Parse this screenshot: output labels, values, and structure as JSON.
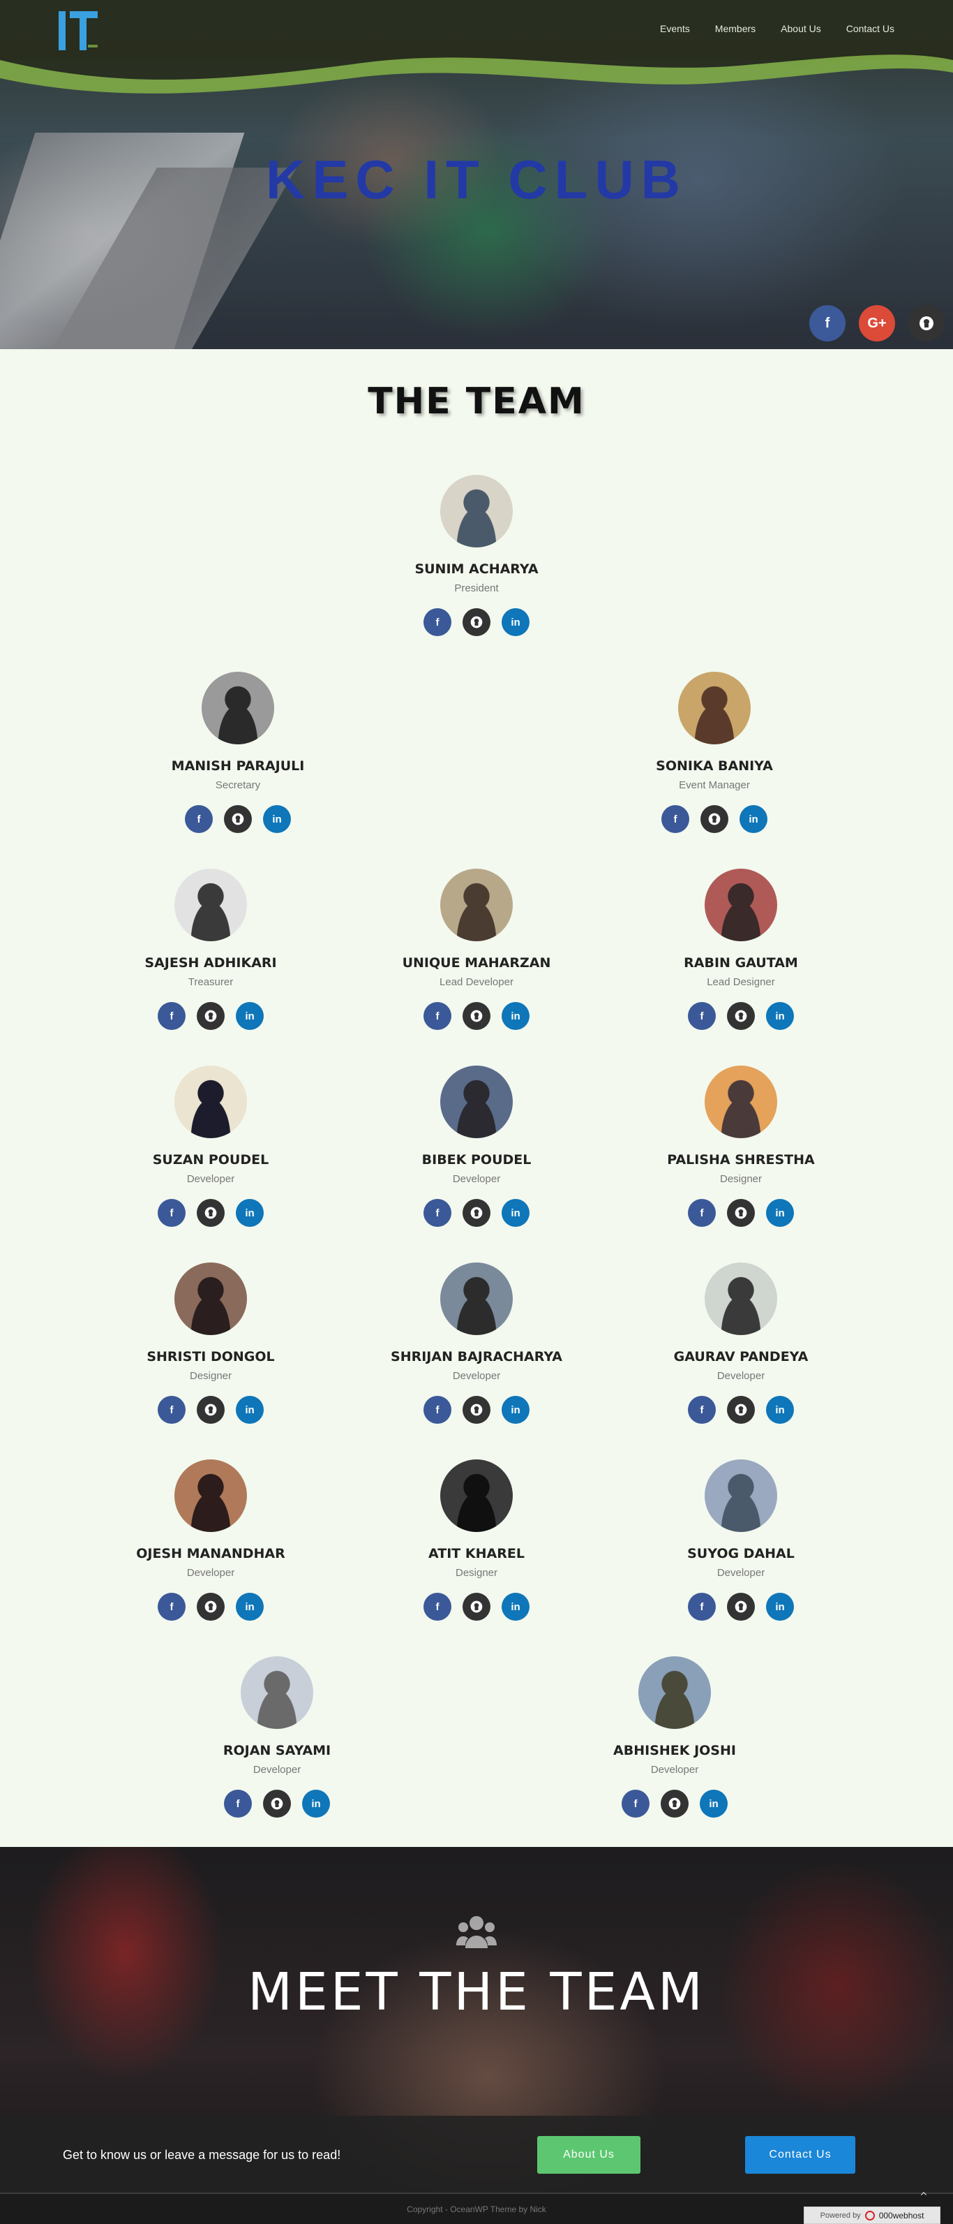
{
  "header": {
    "nav": [
      "Events",
      "Members",
      "About Us",
      "Contact Us"
    ],
    "logo_icon": "it-club-logo"
  },
  "hero": {
    "title": "KEC IT CLUB",
    "social": [
      {
        "icon": "facebook-icon",
        "glyph": "f",
        "color": "#3c5a99"
      },
      {
        "icon": "google-plus-icon",
        "glyph": "G+",
        "color": "#dc4a38"
      },
      {
        "icon": "github-icon",
        "glyph": "",
        "color": "#333333"
      }
    ]
  },
  "team": {
    "title": "THE TEAM",
    "members": [
      {
        "name": "SUNIM ACHARYA",
        "role": "President"
      },
      {
        "name": "MANISH PARAJULI",
        "role": "Secretary"
      },
      {
        "name": "SONIKA BANIYA",
        "role": "Event Manager"
      },
      {
        "name": "SAJESH ADHIKARI",
        "role": "Treasurer"
      },
      {
        "name": "UNIQUE MAHARZAN",
        "role": "Lead Developer"
      },
      {
        "name": "RABIN GAUTAM",
        "role": "Lead Designer"
      },
      {
        "name": "SUZAN POUDEL",
        "role": "Developer"
      },
      {
        "name": "BIBEK POUDEL",
        "role": "Developer"
      },
      {
        "name": "PALISHA SHRESTHA",
        "role": "Designer"
      },
      {
        "name": "SHRISTI DONGOL",
        "role": "Designer"
      },
      {
        "name": "SHRIJAN BAJRACHARYA",
        "role": "Developer"
      },
      {
        "name": "GAURAV PANDEYA",
        "role": "Developer"
      },
      {
        "name": "OJESH MANANDHAR",
        "role": "Developer"
      },
      {
        "name": "ATIT KHAREL",
        "role": "Designer"
      },
      {
        "name": "SUYOG DAHAL",
        "role": "Developer"
      },
      {
        "name": "ROJAN SAYAMI",
        "role": "Developer"
      },
      {
        "name": "ABHISHEK JOSHI",
        "role": "Developer"
      }
    ],
    "member_social_icons": [
      "facebook-icon",
      "github-icon",
      "linkedin-icon"
    ],
    "member_social_glyphs": [
      "f",
      "",
      "in"
    ]
  },
  "meet": {
    "icon": "users-group-icon",
    "title": "MEET THE TEAM",
    "cta_text": "Get to know us or leave a message for us to read!",
    "about_button": "About Us",
    "contact_button": "Contact Us"
  },
  "footer": {
    "copyright": "Copyright - OceanWP Theme by Nick",
    "powered_label": "Powered by",
    "powered_host": "000webhost",
    "scroll_top_icon": "chevron-up-icon"
  },
  "colors": {
    "page_bg": "#f3f9ef",
    "facebook": "#3b5998",
    "github": "#333333",
    "linkedin": "#0e76b9",
    "hero_title": "#2339a6",
    "about_button": "#5cc770",
    "contact_button": "#1b87d8"
  }
}
